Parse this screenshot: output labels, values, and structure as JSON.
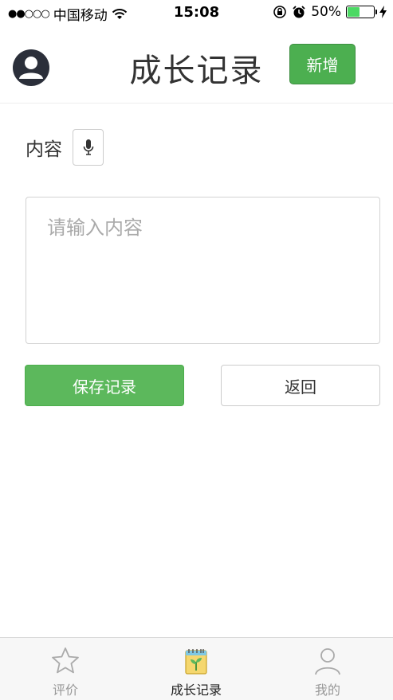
{
  "status_bar": {
    "signal_dots": "●●○○○",
    "carrier": "中国移动",
    "time": "15:08",
    "battery_percent": "50%",
    "battery_level": 0.5
  },
  "header": {
    "title": "成长记录",
    "add_label": "新增"
  },
  "form": {
    "content_label": "内容",
    "content_value": "",
    "content_placeholder": "请输入内容",
    "save_label": "保存记录",
    "back_label": "返回"
  },
  "tab_bar": {
    "items": [
      {
        "label": "评价",
        "icon": "star-icon",
        "active": false
      },
      {
        "label": "成长记录",
        "icon": "notebook-sprout-icon",
        "active": true
      },
      {
        "label": "我的",
        "icon": "person-icon",
        "active": false
      }
    ]
  },
  "colors": {
    "accent_green": "#4caf50",
    "save_green": "#5cb85c",
    "avatar_dark": "#2b2f3a",
    "battery_green": "#4cd964"
  }
}
